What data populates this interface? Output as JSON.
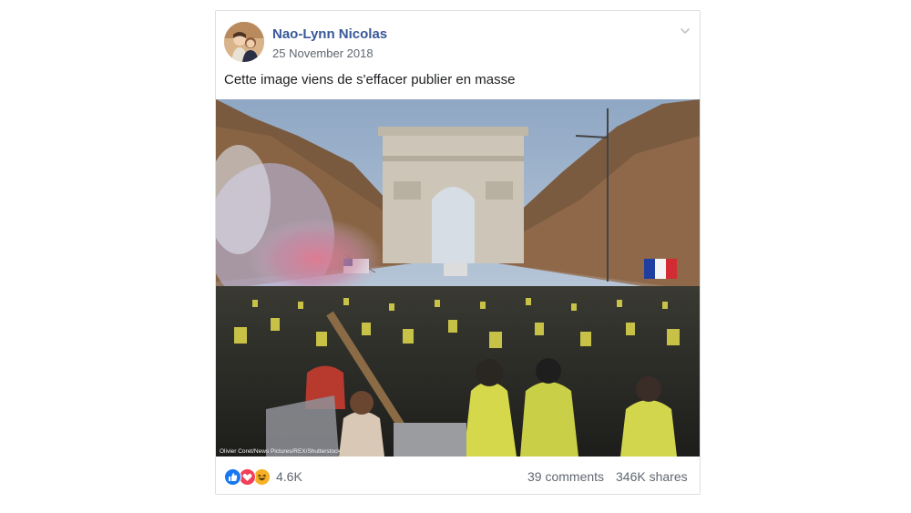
{
  "post": {
    "author": "Nao-Lynn Nicolas",
    "date": "25 November 2018",
    "caption": "Cette image viens de s'effacer publier en masse",
    "photo_credit": "Olivier Coret/News Pictures/REX/Shutterstock"
  },
  "footer": {
    "reaction_icons": [
      "like-icon",
      "love-icon",
      "haha-icon"
    ],
    "reaction_count": "4.6K",
    "comments": "39 comments",
    "shares": "346K shares"
  },
  "colors": {
    "author_link": "#385898",
    "meta_text": "#606770",
    "body_text": "#1c1e21",
    "like": "#1877f2",
    "love": "#f33e58",
    "haha": "#f7b125",
    "card_border": "#dddfe2"
  }
}
